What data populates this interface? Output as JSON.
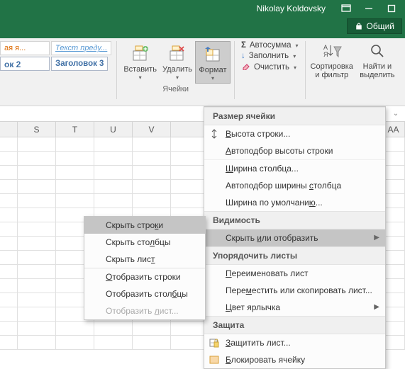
{
  "titlebar": {
    "user": "Nikolay Koldovsky"
  },
  "share": {
    "label": "Общий"
  },
  "styles": {
    "a": "ая я...",
    "b": "Текст преду...",
    "c": "ок 2",
    "d": "Заголовок 3"
  },
  "ribbon": {
    "insert": "Вставить",
    "delete": "Удалить",
    "format": "Формат",
    "cells_group": "Ячейки",
    "autosum": "Автосумма",
    "fill": "Заполнить",
    "clear": "Очистить",
    "sort": "Сортировка",
    "sort2": "и фильтр",
    "find": "Найти и",
    "find2": "выделить"
  },
  "columns": {
    "s": "S",
    "t": "T",
    "u": "U",
    "v": "V",
    "aa": "AA"
  },
  "ctxmenu": {
    "hide_rows_pre": "Скрыть стро",
    "hide_rows_u": "к",
    "hide_rows_post": "и",
    "hide_cols_pre": "Скрыть сто",
    "hide_cols_u": "л",
    "hide_cols_post": "бцы",
    "hide_sheet_pre": "Скрыть лис",
    "hide_sheet_u": "т",
    "show_rows_u": "О",
    "show_rows_post": "тобразить строки",
    "show_cols_pre": "Отобразить стол",
    "show_cols_u": "б",
    "show_cols_post": "цы",
    "show_sheet_pre": "Отобразить ",
    "show_sheet_u": "л",
    "show_sheet_post": "ист..."
  },
  "mainmenu": {
    "sec_size": "Размер ячейки",
    "row_h_u": "В",
    "row_h_post": "ысота строки...",
    "autofit_h_u": "А",
    "autofit_h_post": "втоподбор высоты строки",
    "col_w_u": "Ш",
    "col_w_post": "ирина столбца...",
    "autofit_w_pre": "Автоподбор ширины ",
    "autofit_w_u": "с",
    "autofit_w_post": "толбца",
    "def_w_pre": "Ширина по умолчани",
    "def_w_u": "ю",
    "def_w_post": "...",
    "sec_vis": "Видимость",
    "hideshow_pre": "Скрыть ",
    "hideshow_u": "и",
    "hideshow_post": "ли отобразить",
    "sec_sheets": "Упорядочить листы",
    "rename_u": "П",
    "rename_post": "ереименовать лист",
    "move_pre": "Пере",
    "move_u": "м",
    "move_post": "естить или скопировать лист...",
    "tabcolor_u": "Ц",
    "tabcolor_post": "вет ярлычка",
    "sec_protect": "Защита",
    "protect_u": "З",
    "protect_post": "ащитить лист...",
    "lock_u": "Б",
    "lock_post": "локировать ячейку"
  }
}
